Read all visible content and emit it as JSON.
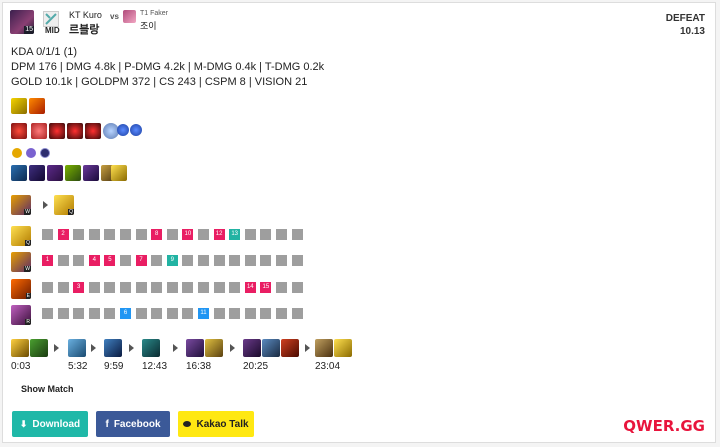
{
  "header": {
    "champion_level": "15",
    "position": "MID",
    "player_team": "KT Kuro",
    "player_champ_name": "르블랑",
    "vs_label": "vs",
    "opponent_team": "T1 Faker",
    "opponent_champ_name": "조이",
    "result": "DEFEAT",
    "patch": "10.13"
  },
  "stats": {
    "line1": "KDA 0/1/1 (1)",
    "line2": "DPM 176 | DMG 4.8k | P-DMG 4.2k | M-DMG 0.4k | T-DMG 0.2k",
    "line3": "GOLD 10.1k | GOLDPM 372 | CS 243 | CSPM 8 | VISION 21"
  },
  "skill_order": {
    "rows": [
      {
        "key": "Q",
        "marks": {
          "2": "2",
          "8": "8",
          "10": "10",
          "12": "12",
          "13": "13"
        }
      },
      {
        "key": "W",
        "marks": {
          "1": "1",
          "4": "4",
          "5": "5",
          "7": "7",
          "9": "9"
        }
      },
      {
        "key": "E",
        "marks": {
          "3": "3",
          "14": "14",
          "15": "15"
        }
      },
      {
        "key": "R",
        "marks": {
          "6": "6",
          "11": "11"
        }
      }
    ]
  },
  "build_times": [
    "0:03",
    "5:32",
    "9:59",
    "12:43",
    "16:38",
    "20:25",
    "23:04"
  ],
  "buttons": {
    "show_match": "Show Match",
    "download": "Download",
    "facebook": "Facebook",
    "kakao": "Kakao Talk"
  },
  "brand": "QWER.GG",
  "colors": {
    "download": "#1fb8a8",
    "facebook": "#3b5998",
    "kakao": "#ffe812",
    "brand": "#e8143c",
    "skill_highlight": "#e91e63",
    "skill_teal": "#22b3a3",
    "skill_blue": "#2196f3"
  }
}
